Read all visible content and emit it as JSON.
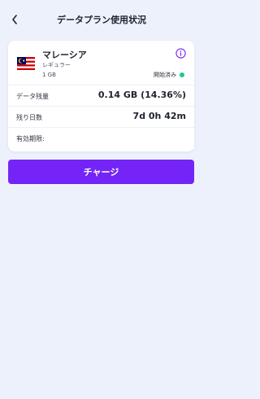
{
  "header": {
    "title": "データプラン使用状況",
    "back_icon": "chevron-left-icon"
  },
  "plan": {
    "country": "マレーシア",
    "type": "レギュラー",
    "size": "1 GB",
    "status": "開始済み",
    "status_color": "#1ec98a",
    "flag_icon": "malaysia-flag-icon",
    "info_icon": "info-icon"
  },
  "details": {
    "remaining_data_label": "データ残量",
    "remaining_data_value": "0.14 GB (14.36%)",
    "remaining_days_label": "残り日数",
    "remaining_days_value": "7d 0h 42m",
    "expiry_label": "有効期限:",
    "expiry_value": ""
  },
  "actions": {
    "charge_label": "チャージ"
  },
  "colors": {
    "accent": "#7424f6",
    "background": "#edf1fb"
  }
}
